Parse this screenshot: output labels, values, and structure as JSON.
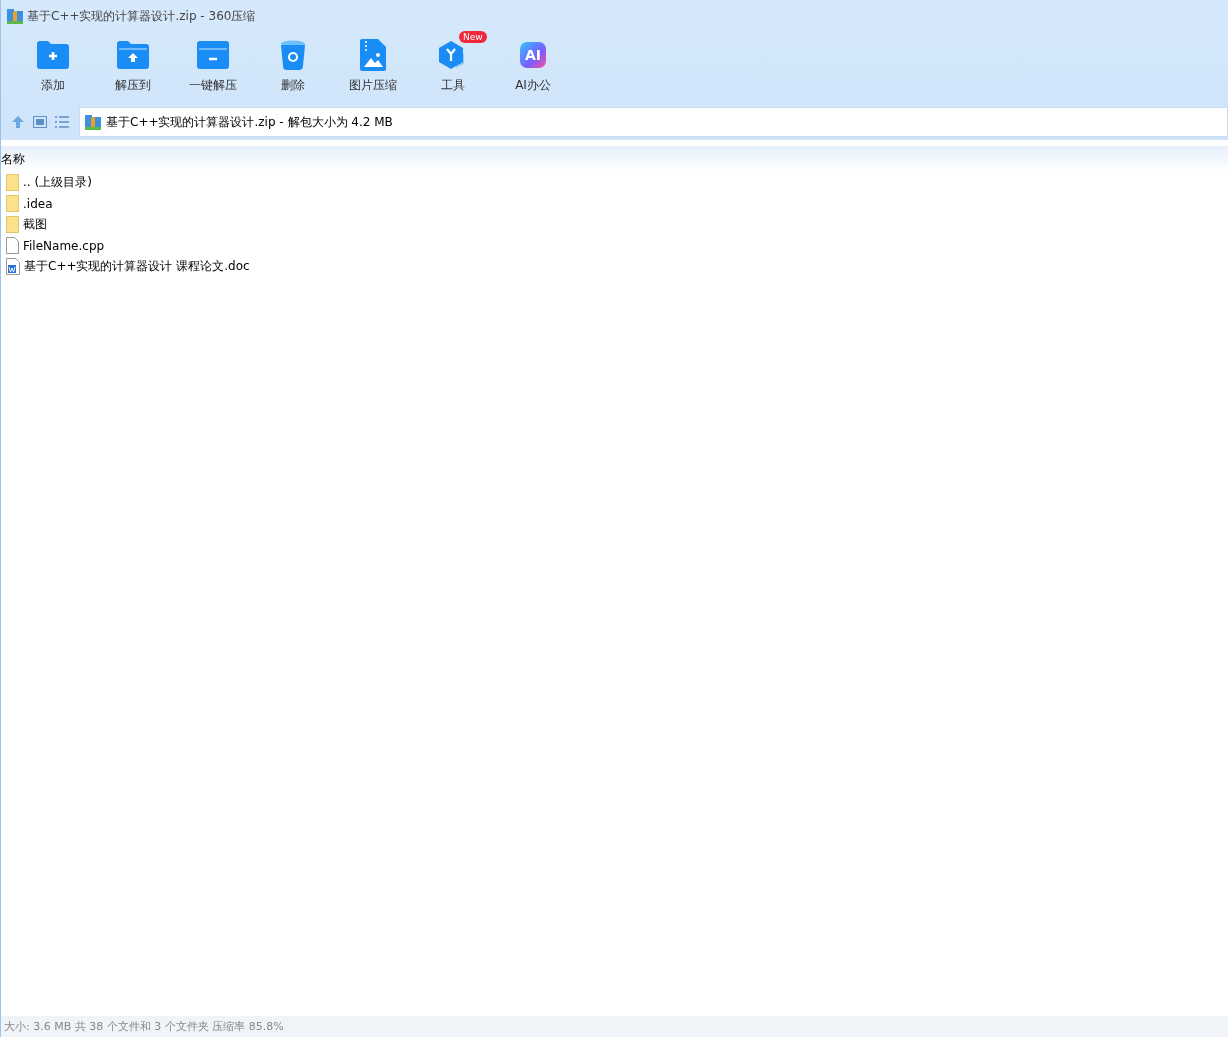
{
  "window": {
    "title": "基于C++实现的计算器设计.zip - 360压缩"
  },
  "toolbar": [
    {
      "kind": "add",
      "label": "添加"
    },
    {
      "kind": "extract",
      "label": "解压到"
    },
    {
      "kind": "oneclick",
      "label": "一键解压"
    },
    {
      "kind": "delete",
      "label": "删除"
    },
    {
      "kind": "image",
      "label": "图片压缩"
    },
    {
      "kind": "tools",
      "label": "工具",
      "badge": "New"
    },
    {
      "kind": "ai",
      "label": "AI办公",
      "icon_text": "AI"
    }
  ],
  "address": {
    "path": "基于C++实现的计算器设计.zip - 解包大小为 4.2 MB"
  },
  "table": {
    "columns": [
      "名称"
    ],
    "rows": [
      {
        "kind": "folder",
        "name": ".. (上级目录)"
      },
      {
        "kind": "folder",
        "name": ".idea"
      },
      {
        "kind": "folder",
        "name": "截图"
      },
      {
        "kind": "file",
        "name": "FileName.cpp"
      },
      {
        "kind": "doc",
        "name": "基于C++实现的计算器设计 课程论文.doc"
      }
    ]
  },
  "status_bar": "大小: 3.6 MB 共 38 个文件和 3 个文件夹 压缩率 85.8%"
}
